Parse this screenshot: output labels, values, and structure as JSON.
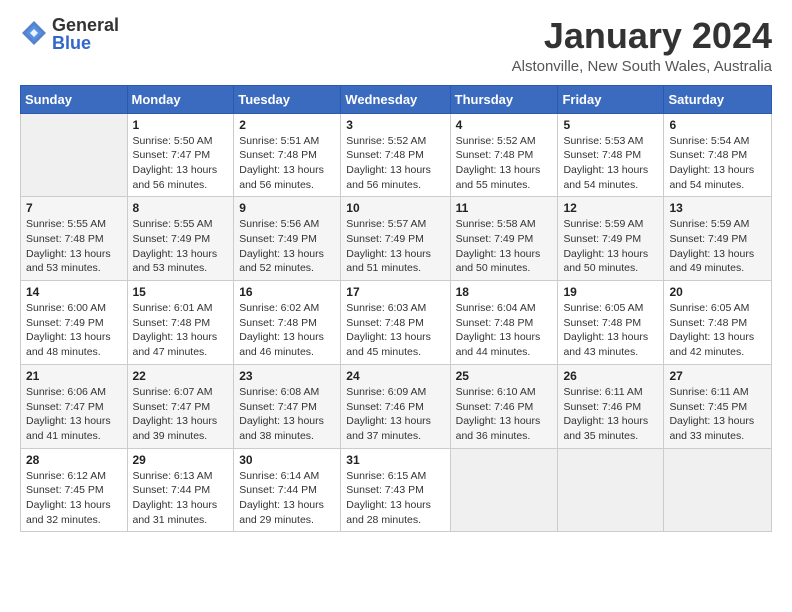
{
  "logo": {
    "general": "General",
    "blue": "Blue"
  },
  "header": {
    "month": "January 2024",
    "location": "Alstonville, New South Wales, Australia"
  },
  "weekdays": [
    "Sunday",
    "Monday",
    "Tuesday",
    "Wednesday",
    "Thursday",
    "Friday",
    "Saturday"
  ],
  "weeks": [
    [
      {
        "day": "",
        "empty": true
      },
      {
        "day": "1",
        "sunrise": "Sunrise: 5:50 AM",
        "sunset": "Sunset: 7:47 PM",
        "daylight": "Daylight: 13 hours and 56 minutes."
      },
      {
        "day": "2",
        "sunrise": "Sunrise: 5:51 AM",
        "sunset": "Sunset: 7:48 PM",
        "daylight": "Daylight: 13 hours and 56 minutes."
      },
      {
        "day": "3",
        "sunrise": "Sunrise: 5:52 AM",
        "sunset": "Sunset: 7:48 PM",
        "daylight": "Daylight: 13 hours and 56 minutes."
      },
      {
        "day": "4",
        "sunrise": "Sunrise: 5:52 AM",
        "sunset": "Sunset: 7:48 PM",
        "daylight": "Daylight: 13 hours and 55 minutes."
      },
      {
        "day": "5",
        "sunrise": "Sunrise: 5:53 AM",
        "sunset": "Sunset: 7:48 PM",
        "daylight": "Daylight: 13 hours and 54 minutes."
      },
      {
        "day": "6",
        "sunrise": "Sunrise: 5:54 AM",
        "sunset": "Sunset: 7:48 PM",
        "daylight": "Daylight: 13 hours and 54 minutes."
      }
    ],
    [
      {
        "day": "7",
        "sunrise": "Sunrise: 5:55 AM",
        "sunset": "Sunset: 7:48 PM",
        "daylight": "Daylight: 13 hours and 53 minutes."
      },
      {
        "day": "8",
        "sunrise": "Sunrise: 5:55 AM",
        "sunset": "Sunset: 7:49 PM",
        "daylight": "Daylight: 13 hours and 53 minutes."
      },
      {
        "day": "9",
        "sunrise": "Sunrise: 5:56 AM",
        "sunset": "Sunset: 7:49 PM",
        "daylight": "Daylight: 13 hours and 52 minutes."
      },
      {
        "day": "10",
        "sunrise": "Sunrise: 5:57 AM",
        "sunset": "Sunset: 7:49 PM",
        "daylight": "Daylight: 13 hours and 51 minutes."
      },
      {
        "day": "11",
        "sunrise": "Sunrise: 5:58 AM",
        "sunset": "Sunset: 7:49 PM",
        "daylight": "Daylight: 13 hours and 50 minutes."
      },
      {
        "day": "12",
        "sunrise": "Sunrise: 5:59 AM",
        "sunset": "Sunset: 7:49 PM",
        "daylight": "Daylight: 13 hours and 50 minutes."
      },
      {
        "day": "13",
        "sunrise": "Sunrise: 5:59 AM",
        "sunset": "Sunset: 7:49 PM",
        "daylight": "Daylight: 13 hours and 49 minutes."
      }
    ],
    [
      {
        "day": "14",
        "sunrise": "Sunrise: 6:00 AM",
        "sunset": "Sunset: 7:49 PM",
        "daylight": "Daylight: 13 hours and 48 minutes."
      },
      {
        "day": "15",
        "sunrise": "Sunrise: 6:01 AM",
        "sunset": "Sunset: 7:48 PM",
        "daylight": "Daylight: 13 hours and 47 minutes."
      },
      {
        "day": "16",
        "sunrise": "Sunrise: 6:02 AM",
        "sunset": "Sunset: 7:48 PM",
        "daylight": "Daylight: 13 hours and 46 minutes."
      },
      {
        "day": "17",
        "sunrise": "Sunrise: 6:03 AM",
        "sunset": "Sunset: 7:48 PM",
        "daylight": "Daylight: 13 hours and 45 minutes."
      },
      {
        "day": "18",
        "sunrise": "Sunrise: 6:04 AM",
        "sunset": "Sunset: 7:48 PM",
        "daylight": "Daylight: 13 hours and 44 minutes."
      },
      {
        "day": "19",
        "sunrise": "Sunrise: 6:05 AM",
        "sunset": "Sunset: 7:48 PM",
        "daylight": "Daylight: 13 hours and 43 minutes."
      },
      {
        "day": "20",
        "sunrise": "Sunrise: 6:05 AM",
        "sunset": "Sunset: 7:48 PM",
        "daylight": "Daylight: 13 hours and 42 minutes."
      }
    ],
    [
      {
        "day": "21",
        "sunrise": "Sunrise: 6:06 AM",
        "sunset": "Sunset: 7:47 PM",
        "daylight": "Daylight: 13 hours and 41 minutes."
      },
      {
        "day": "22",
        "sunrise": "Sunrise: 6:07 AM",
        "sunset": "Sunset: 7:47 PM",
        "daylight": "Daylight: 13 hours and 39 minutes."
      },
      {
        "day": "23",
        "sunrise": "Sunrise: 6:08 AM",
        "sunset": "Sunset: 7:47 PM",
        "daylight": "Daylight: 13 hours and 38 minutes."
      },
      {
        "day": "24",
        "sunrise": "Sunrise: 6:09 AM",
        "sunset": "Sunset: 7:46 PM",
        "daylight": "Daylight: 13 hours and 37 minutes."
      },
      {
        "day": "25",
        "sunrise": "Sunrise: 6:10 AM",
        "sunset": "Sunset: 7:46 PM",
        "daylight": "Daylight: 13 hours and 36 minutes."
      },
      {
        "day": "26",
        "sunrise": "Sunrise: 6:11 AM",
        "sunset": "Sunset: 7:46 PM",
        "daylight": "Daylight: 13 hours and 35 minutes."
      },
      {
        "day": "27",
        "sunrise": "Sunrise: 6:11 AM",
        "sunset": "Sunset: 7:45 PM",
        "daylight": "Daylight: 13 hours and 33 minutes."
      }
    ],
    [
      {
        "day": "28",
        "sunrise": "Sunrise: 6:12 AM",
        "sunset": "Sunset: 7:45 PM",
        "daylight": "Daylight: 13 hours and 32 minutes."
      },
      {
        "day": "29",
        "sunrise": "Sunrise: 6:13 AM",
        "sunset": "Sunset: 7:44 PM",
        "daylight": "Daylight: 13 hours and 31 minutes."
      },
      {
        "day": "30",
        "sunrise": "Sunrise: 6:14 AM",
        "sunset": "Sunset: 7:44 PM",
        "daylight": "Daylight: 13 hours and 29 minutes."
      },
      {
        "day": "31",
        "sunrise": "Sunrise: 6:15 AM",
        "sunset": "Sunset: 7:43 PM",
        "daylight": "Daylight: 13 hours and 28 minutes."
      },
      {
        "day": "",
        "empty": true
      },
      {
        "day": "",
        "empty": true
      },
      {
        "day": "",
        "empty": true
      }
    ]
  ]
}
